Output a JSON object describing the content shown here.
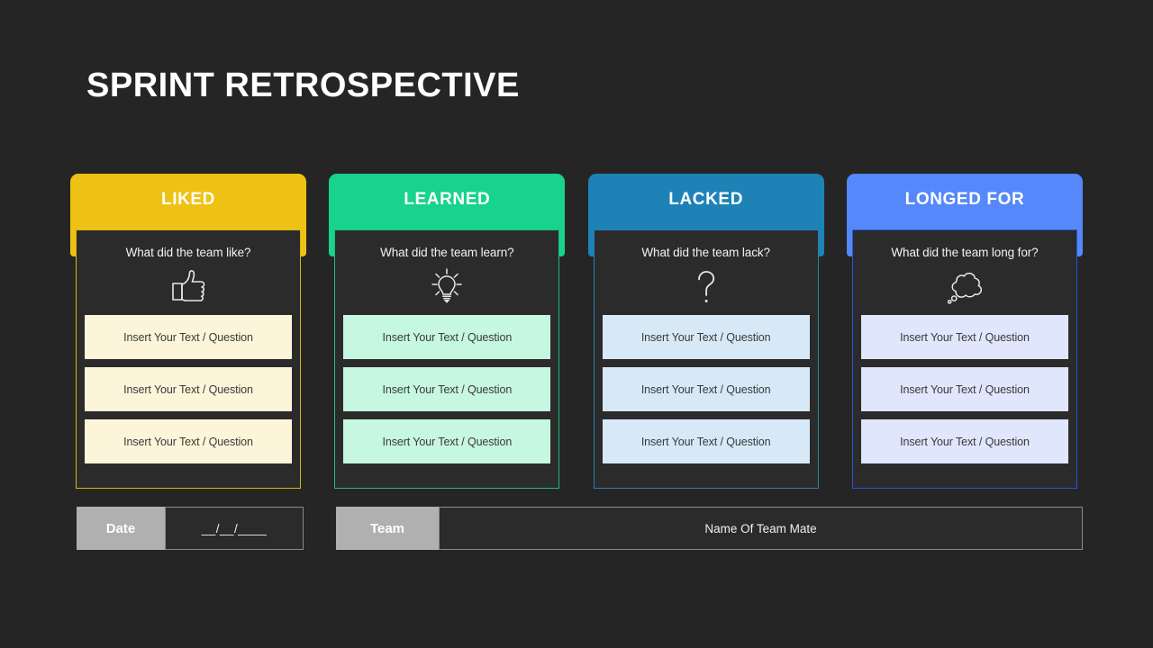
{
  "slide": {
    "title": "SPRINT RETROSPECTIVE",
    "background_color": "#252525"
  },
  "columns": [
    {
      "header": "LIKED",
      "question": "What did the team like?",
      "icon": "thumbs-up-icon",
      "header_color": "#eec214",
      "border_color": "#d9b60f",
      "item_color": "#fcf5d9",
      "items": [
        "Insert Your Text / Question",
        "Insert Your Text / Question",
        "Insert Your Text / Question"
      ]
    },
    {
      "header": "LEARNED",
      "question": "What did the team learn?",
      "icon": "lightbulb-icon",
      "header_color": "#18d38b",
      "border_color": "#1bbd80",
      "item_color": "#c6f7e0",
      "items": [
        "Insert Your Text / Question",
        "Insert Your Text / Question",
        "Insert Your Text / Question"
      ]
    },
    {
      "header": "LACKED",
      "question": "What did the team lack?",
      "icon": "question-mark-icon",
      "header_color": "#1d82b6",
      "border_color": "#2b7fae",
      "item_color": "#d7e9f7",
      "items": [
        "Insert Your Text / Question",
        "Insert Your Text / Question",
        "Insert Your Text / Question"
      ]
    },
    {
      "header": "LONGED FOR",
      "question": "What did the team long for?",
      "icon": "thought-cloud-icon",
      "header_color": "#5588fb",
      "border_color": "#2b54d6",
      "item_color": "#e0e6fb",
      "items": [
        "Insert Your Text / Question",
        "Insert Your Text / Question",
        "Insert Your Text / Question"
      ]
    }
  ],
  "meta": {
    "date_label": "Date",
    "date_value": "__/__/____",
    "team_label": "Team",
    "team_value": "Name Of Team Mate"
  }
}
